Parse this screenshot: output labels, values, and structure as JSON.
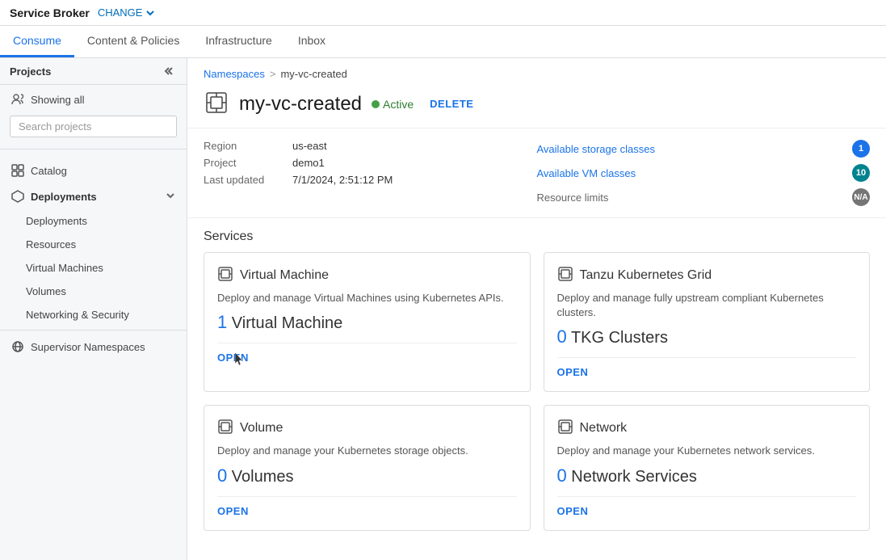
{
  "topbar": {
    "brand": "Service Broker",
    "change_label": "CHANGE"
  },
  "nav": {
    "tabs": [
      {
        "label": "Consume",
        "active": true
      },
      {
        "label": "Content & Policies",
        "active": false
      },
      {
        "label": "Infrastructure",
        "active": false
      },
      {
        "label": "Inbox",
        "active": false
      }
    ]
  },
  "sidebar": {
    "projects_label": "Projects",
    "showing_label": "Showing all",
    "search_placeholder": "Search projects",
    "nav_items": [
      {
        "label": "Catalog",
        "icon": "grid"
      },
      {
        "label": "Deployments",
        "icon": "deploy",
        "has_caret": true
      },
      {
        "label": "Deployments",
        "sub": true
      },
      {
        "label": "Resources",
        "sub": true
      },
      {
        "label": "Virtual Machines",
        "sub": true
      },
      {
        "label": "Volumes",
        "sub": true
      },
      {
        "label": "Networking & Security",
        "sub": true
      },
      {
        "label": "Supervisor Namespaces",
        "icon": "namespace"
      }
    ]
  },
  "breadcrumb": {
    "link": "Namespaces",
    "separator": ">",
    "current": "my-vc-created"
  },
  "page": {
    "title": "my-vc-created",
    "status": "Active",
    "delete_label": "DELETE",
    "meta": {
      "region_label": "Region",
      "region_value": "us-east",
      "project_label": "Project",
      "project_value": "demo1",
      "last_updated_label": "Last updated",
      "last_updated_value": "7/1/2024, 2:51:12 PM"
    },
    "links": [
      {
        "label": "Available storage classes",
        "badge": "1",
        "badge_type": "blue"
      },
      {
        "label": "Available VM classes",
        "badge": "10",
        "badge_type": "teal"
      },
      {
        "label": "Resource limits",
        "badge": "N/A",
        "badge_type": "gray"
      }
    ]
  },
  "services": {
    "section_label": "Services",
    "cards": [
      {
        "title": "Virtual Machine",
        "icon": "box",
        "desc": "Deploy and manage Virtual Machines using Kubernetes APIs.",
        "count_num": "1",
        "count_label": "Virtual Machine",
        "open_label": "OPEN"
      },
      {
        "title": "Tanzu Kubernetes Grid",
        "icon": "box",
        "desc": "Deploy and manage fully upstream compliant Kubernetes clusters.",
        "count_num": "0",
        "count_label": "TKG Clusters",
        "open_label": "OPEN"
      },
      {
        "title": "Volume",
        "icon": "box",
        "desc": "Deploy and manage your Kubernetes storage objects.",
        "count_num": "0",
        "count_label": "Volumes",
        "open_label": "OPEN"
      },
      {
        "title": "Network",
        "icon": "box",
        "desc": "Deploy and manage your Kubernetes network services.",
        "count_num": "0",
        "count_label": "Network Services",
        "open_label": "OPEN"
      }
    ]
  }
}
